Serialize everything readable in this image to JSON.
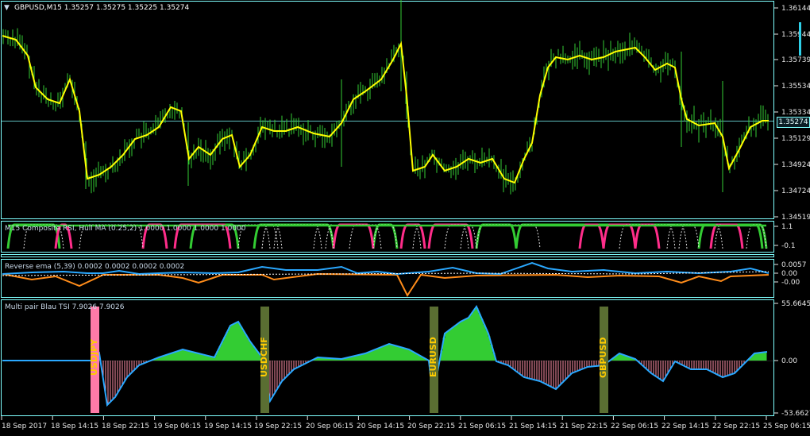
{
  "main": {
    "header": "GBPUSD,M15  1.35257 1.35275 1.35225 1.35274",
    "current_price": "1.35274",
    "price_ticks": [
      "1.36144",
      "1.35944",
      "1.35739",
      "1.35534",
      "1.35334",
      "1.35129",
      "1.34924",
      "1.34724",
      "1.34519"
    ]
  },
  "rsi": {
    "header": "M15 Composite RSI, Hull MA (0.25,2) 1.0000 1.0000 1.0000 1.0000",
    "ticks": [
      "1.1",
      "-0.1"
    ]
  },
  "ema": {
    "header": "Reverse ema (5,39) 0.0002 0.0002 0.0002 0.0002",
    "ticks": [
      "0.0057",
      "0.00",
      "-0.00"
    ]
  },
  "tsi": {
    "header": "Multi pair Blau TSI 7.9026 7.9026",
    "ticks": [
      "55.6645",
      "0.00",
      "-53.6627"
    ],
    "pairs": [
      "USDJPY",
      "USDCHF",
      "EURUSD",
      "GBPUSD"
    ]
  },
  "time_axis": [
    "18 Sep 2017",
    "18 Sep 14:15",
    "18 Sep 22:15",
    "19 Sep 06:15",
    "19 Sep 14:15",
    "19 Sep 22:15",
    "20 Sep 06:15",
    "20 Sep 14:15",
    "20 Sep 22:15",
    "21 Sep 06:15",
    "21 Sep 14:15",
    "21 Sep 22:15",
    "22 Sep 06:15",
    "22 Sep 14:15",
    "22 Sep 22:15",
    "25 Sep 06:15"
  ],
  "colors": {
    "frame": "#7fffff",
    "bars": "#33cc33",
    "ma": "#ffff00",
    "green": "#33cc33",
    "pink": "#ff2d8a",
    "blue": "#2aa8ff",
    "orange": "#ff8c1a",
    "pink_hist": "#ff8fa8",
    "bar_olive": "#5a6e32",
    "bar_pink": "#ff7aa8"
  }
}
